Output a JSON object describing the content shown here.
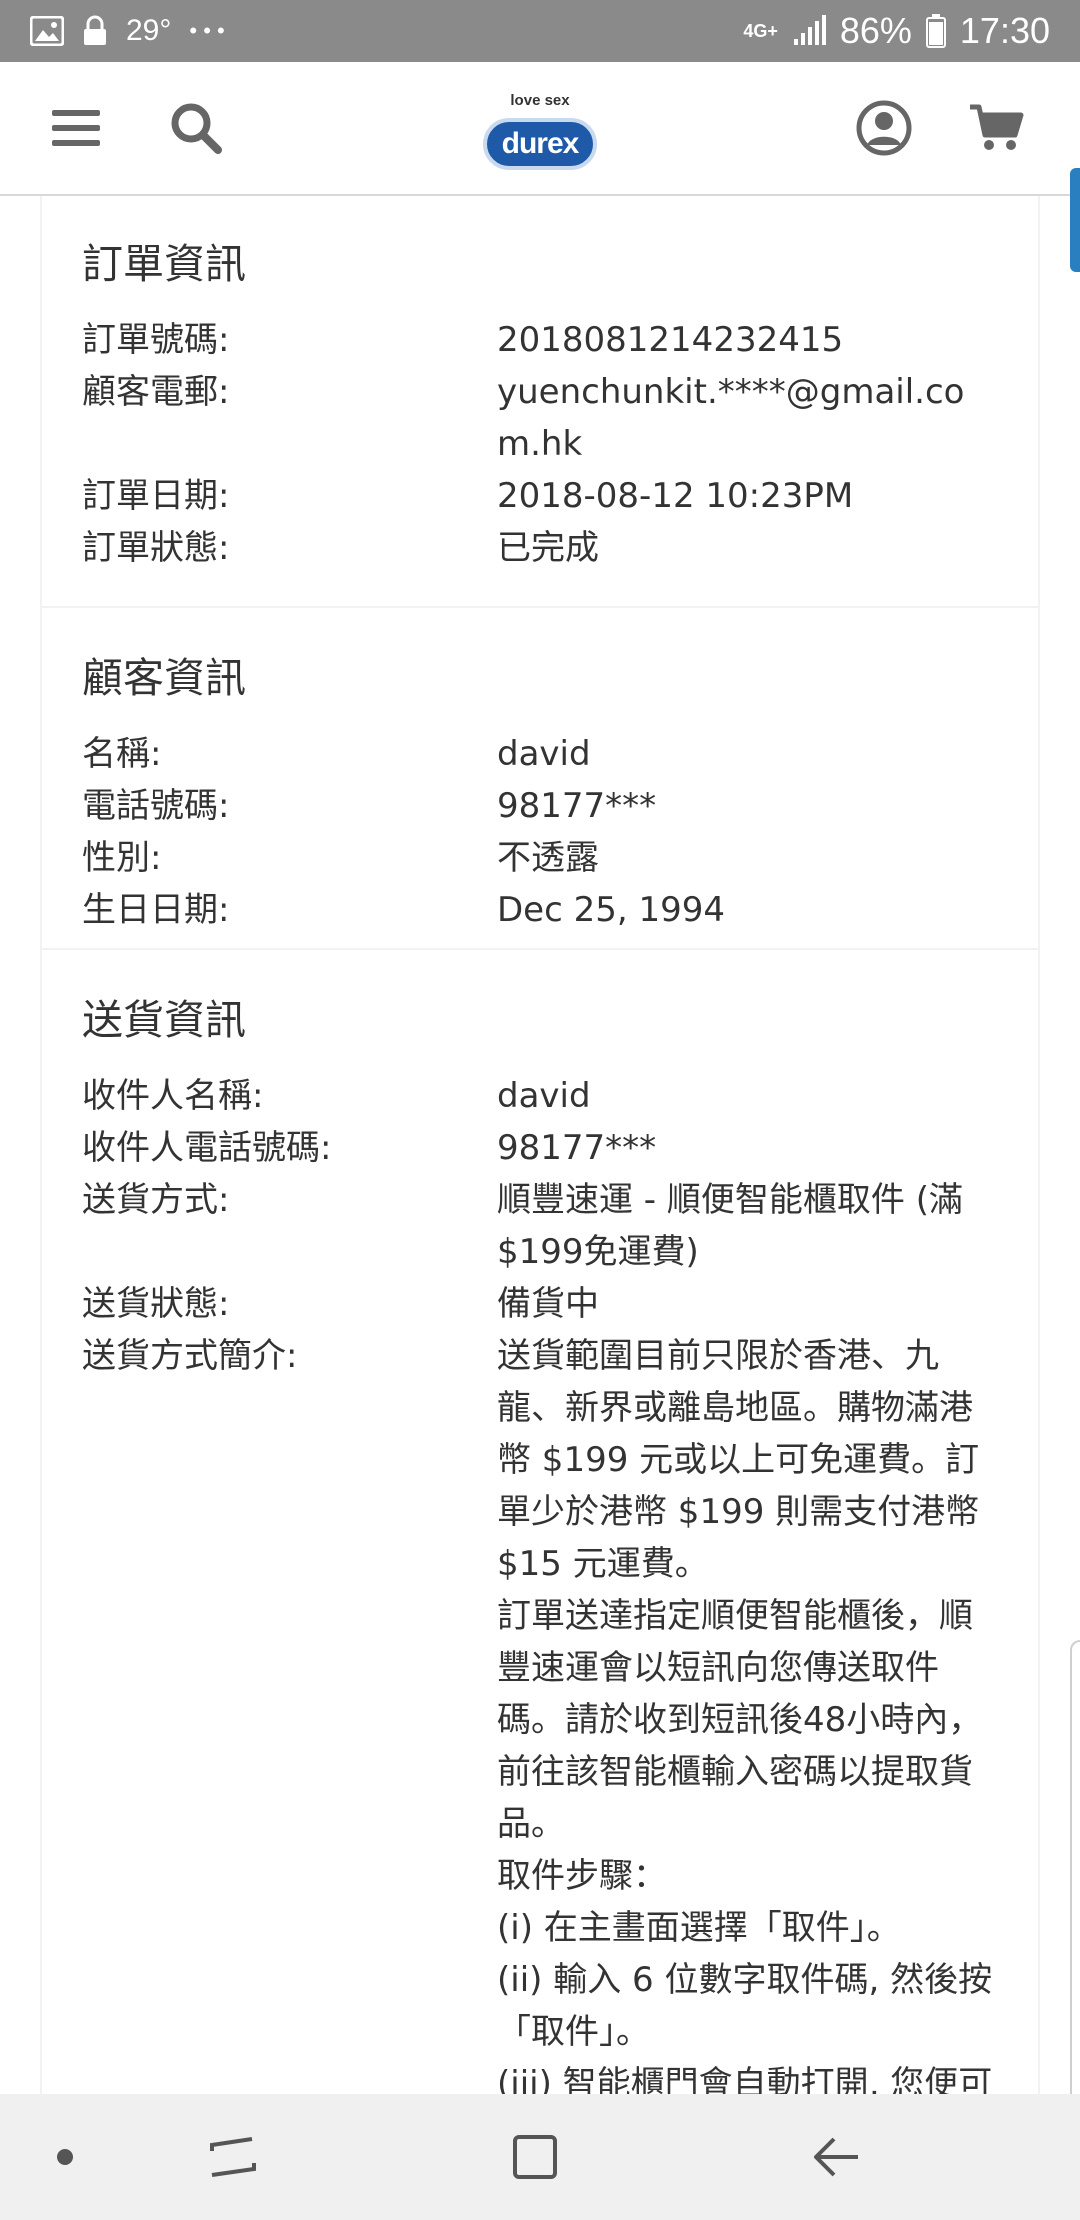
{
  "status_bar": {
    "temperature": "29°",
    "dots": "• • •",
    "network": "4G+",
    "battery": "86%",
    "time": "17:30"
  },
  "header": {
    "logo_tagline": "love sex",
    "logo_word": "durex",
    "icons": [
      "menu-icon",
      "search-icon",
      "account-icon",
      "cart-icon"
    ]
  },
  "order_info": {
    "title": "訂單資訊",
    "rows": [
      {
        "label": "訂單號碼:",
        "value": "2018081214232415"
      },
      {
        "label": "顧客電郵:",
        "value": "yuenchunkit.****@gmail.co\nm.hk"
      },
      {
        "label": "訂單日期:",
        "value": "2018-08-12 10:23PM"
      },
      {
        "label": "訂單狀態:",
        "value": "已完成"
      }
    ]
  },
  "customer_info": {
    "title": "顧客資訊",
    "rows": [
      {
        "label": "名稱:",
        "value": "david"
      },
      {
        "label": "電話號碼:",
        "value": "98177***"
      },
      {
        "label": "性別:",
        "value": "不透露"
      },
      {
        "label": "生日日期:",
        "value": "Dec 25, 1994"
      }
    ]
  },
  "shipping_info": {
    "title": "送貨資訊",
    "rows": [
      {
        "label": "收件人名稱:",
        "value": "david"
      },
      {
        "label": "收件人電話號碼:",
        "value": "98177***"
      },
      {
        "label": "送貨方式:",
        "value": "順豐速運 - 順便智能櫃取件 (滿\n$199免運費)"
      },
      {
        "label": "送貨狀態:",
        "value": "備貨中"
      },
      {
        "label": "送貨方式簡介:",
        "value": "送貨範圍目前只限於香港、九\n龍、新界或離島地區。購物滿港\n幣 $199 元或以上可免運費。訂\n單少於港幣 $199 則需支付港幣\n $15 元運費。\n訂單送達指定順便智能櫃後，順\n豐速運會以短訊向您傳送取件\n碼。請於收到短訊後48小時內，\n前往該智能櫃輸入密碼以提取貨\n品。\n取件步驟：\n(i) 在主畫面選擇「取件」。\n(ii) 輸入 6 位數字取件碼, 然後按\n「取件」。\n(iii) 智能櫃門會自動打開, 您便可"
      }
    ]
  },
  "nav_bar": {
    "icons": [
      "dot-icon",
      "recent-apps-icon",
      "home-icon",
      "back-icon"
    ]
  }
}
